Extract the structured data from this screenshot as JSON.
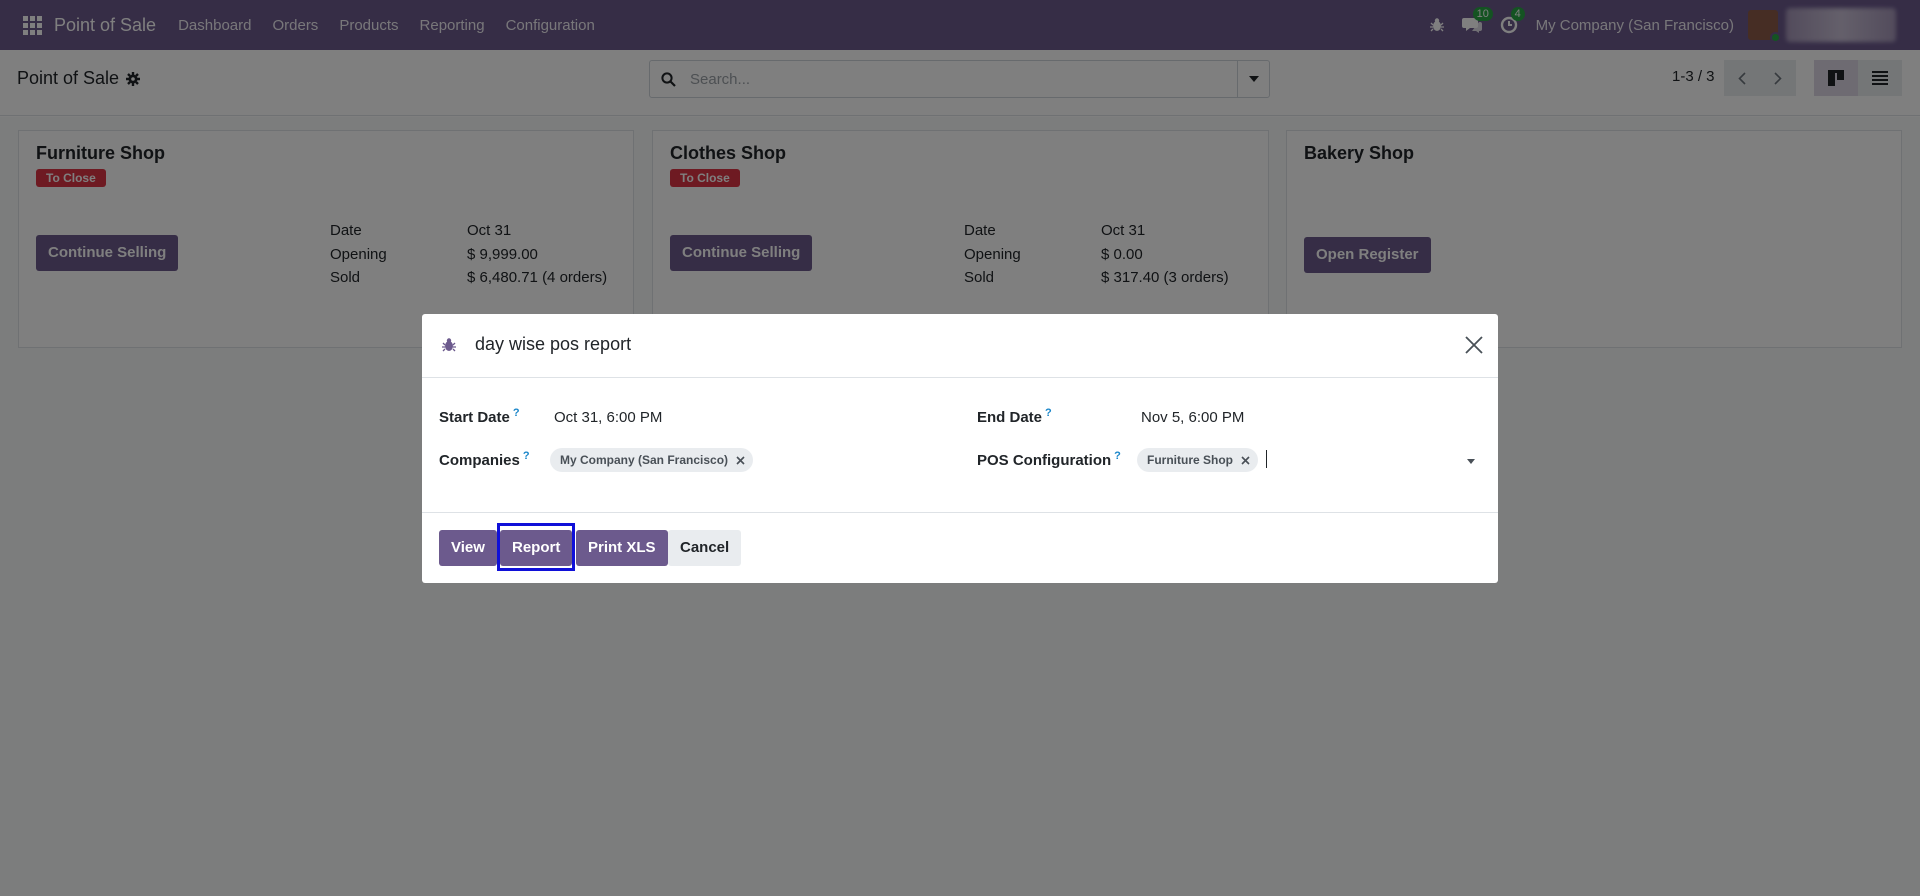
{
  "navbar": {
    "brand": "Point of Sale",
    "menu": [
      "Dashboard",
      "Orders",
      "Products",
      "Reporting",
      "Configuration"
    ],
    "messages_count": "10",
    "activities_count": "4",
    "company": "My Company (San Francisco)"
  },
  "control": {
    "title": "Point of Sale",
    "search_placeholder": "Search...",
    "pager": "1-3 / 3"
  },
  "cards": [
    {
      "title": "Furniture Shop",
      "badge": "To Close",
      "button": "Continue Selling",
      "rows": [
        {
          "label": "Date",
          "value": "Oct 31"
        },
        {
          "label": "Opening",
          "value": "$ 9,999.00"
        },
        {
          "label": "Sold",
          "value": "$ 6,480.71 (4 orders)"
        }
      ]
    },
    {
      "title": "Clothes Shop",
      "badge": "To Close",
      "button": "Continue Selling",
      "rows": [
        {
          "label": "Date",
          "value": "Oct 31"
        },
        {
          "label": "Opening",
          "value": "$ 0.00"
        },
        {
          "label": "Sold",
          "value": "$ 317.40 (3 orders)"
        }
      ]
    },
    {
      "title": "Bakery Shop",
      "button": "Open Register"
    }
  ],
  "dialog": {
    "title": "day wise pos report",
    "start_date_label": "Start Date",
    "start_date_value": "Oct 31, 6:00 PM",
    "end_date_label": "End Date",
    "end_date_value": "Nov 5, 6:00 PM",
    "companies_label": "Companies",
    "companies_tag": "My Company (San Francisco)",
    "pos_config_label": "POS Configuration",
    "pos_config_tag": "Furniture Shop",
    "help_mark": "?",
    "buttons": {
      "view": "View",
      "report": "Report",
      "print_xls": "Print XLS",
      "cancel": "Cancel"
    }
  },
  "colors": {
    "navbar": "#6c5a8d",
    "primary": "#6c5a8d",
    "danger": "#dc3545",
    "success": "#28a745",
    "focus": "#1010d8"
  }
}
